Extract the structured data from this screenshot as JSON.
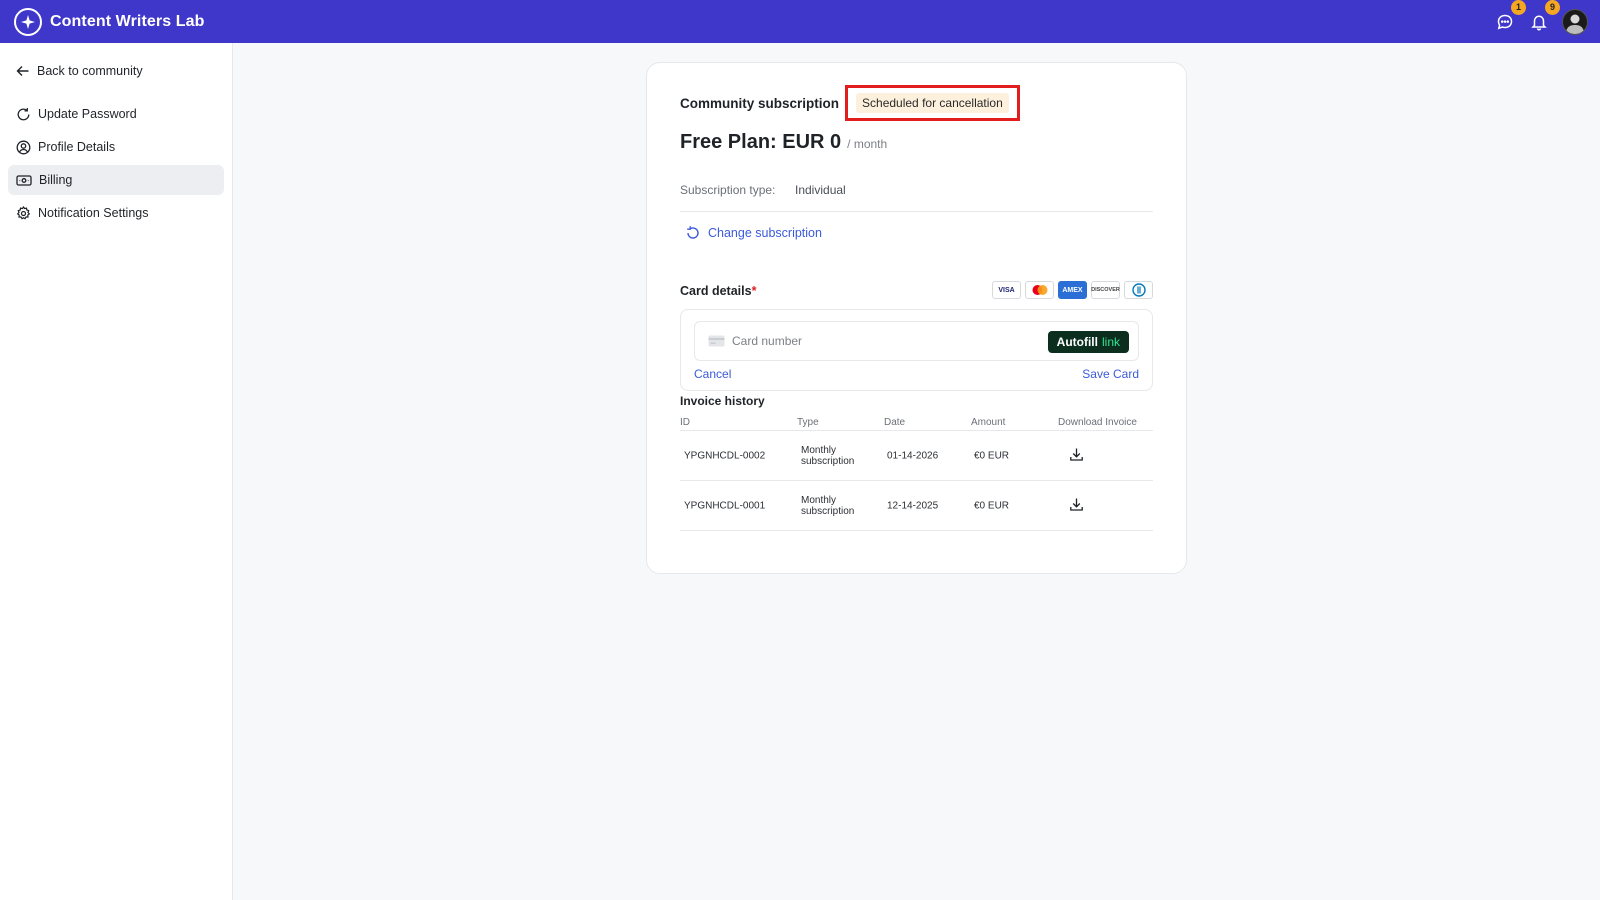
{
  "app": {
    "title": "Content Writers Lab"
  },
  "topbar": {
    "chat_badge": "1",
    "notifications_badge": "9"
  },
  "sidebar": {
    "back_label": "Back to community",
    "items": [
      {
        "label": "Update Password",
        "icon": "refresh-icon"
      },
      {
        "label": "Profile Details",
        "icon": "user-circle-icon"
      },
      {
        "label": "Billing",
        "icon": "billing-icon",
        "active": true
      },
      {
        "label": "Notification Settings",
        "icon": "gear-icon"
      }
    ]
  },
  "subscription": {
    "title": "Community subscription",
    "status": "Scheduled for cancellation",
    "plan": "Free Plan: EUR 0",
    "period": "/ month",
    "type_label": "Subscription type:",
    "type_value": "Individual",
    "change_label": "Change subscription"
  },
  "card_details": {
    "label": "Card details",
    "required_mark": "*",
    "brands": [
      "VISA",
      "mastercard",
      "AMEX",
      "DISCOVER",
      "diners-club"
    ],
    "placeholder": "Card number",
    "autofill_label": "Autofill",
    "autofill_link": "link",
    "cancel_label": "Cancel",
    "save_label": "Save Card"
  },
  "invoices": {
    "title": "Invoice history",
    "columns": [
      "ID",
      "Type",
      "Date",
      "Amount",
      "Download Invoice"
    ],
    "rows": [
      {
        "id": "YPGNHCDL-0002",
        "type": "Monthly subscription",
        "date": "01-14-2026",
        "amount": "€0 EUR"
      },
      {
        "id": "YPGNHCDL-0001",
        "type": "Monthly subscription",
        "date": "12-14-2025",
        "amount": "€0 EUR"
      }
    ]
  },
  "colors": {
    "topbar": "#3f37c9",
    "accent_link": "#3b5bdb",
    "highlight": "#e11d1d",
    "status_pill": "#fdf0dc"
  }
}
